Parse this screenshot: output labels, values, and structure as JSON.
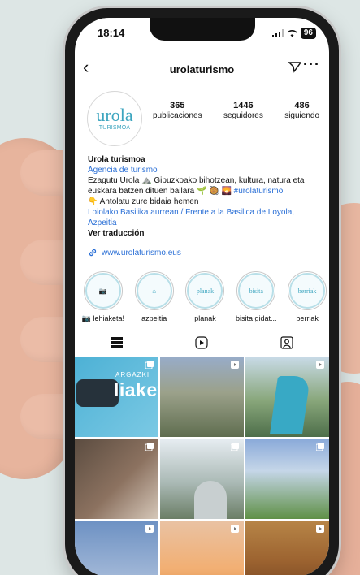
{
  "status": {
    "time": "18:14",
    "battery": "96"
  },
  "header": {
    "username": "urolaturismo"
  },
  "profile": {
    "avatar_word": "urola",
    "avatar_sub": "TURISMOA",
    "stats": [
      {
        "value": "365",
        "label": "publicaciones"
      },
      {
        "value": "1446",
        "label": "seguidores"
      },
      {
        "value": "486",
        "label": "siguiendo"
      }
    ]
  },
  "bio": {
    "name": "Urola turismoa",
    "category": "Agencia de turismo",
    "line1": "Ezagutu Urola ⛰️ Gipuzkoako bihotzean, kultura, natura eta euskara batzen dituen bailara 🌱 🥘 🌄",
    "hashtag": "#urolaturismo",
    "line2": "👇 Antolatu zure bidaia hemen",
    "location": "Loiolako Basilika aurrean / Frente a la Basilica de Loyola, Azpeitia",
    "translate": "Ver traducción"
  },
  "link": {
    "url": "www.urolaturismo.eus"
  },
  "highlights": [
    {
      "label": "📷 lehiaketa!",
      "inner": "📷"
    },
    {
      "label": "azpeitia",
      "inner": "⌂"
    },
    {
      "label": "planak",
      "inner": "planak"
    },
    {
      "label": "bisita gidat...",
      "inner": "bisita"
    },
    {
      "label": "berriak",
      "inner": "berriak"
    }
  ],
  "posts": {
    "post1_small": "ARGAZKI",
    "post1_big": "liaketa"
  }
}
